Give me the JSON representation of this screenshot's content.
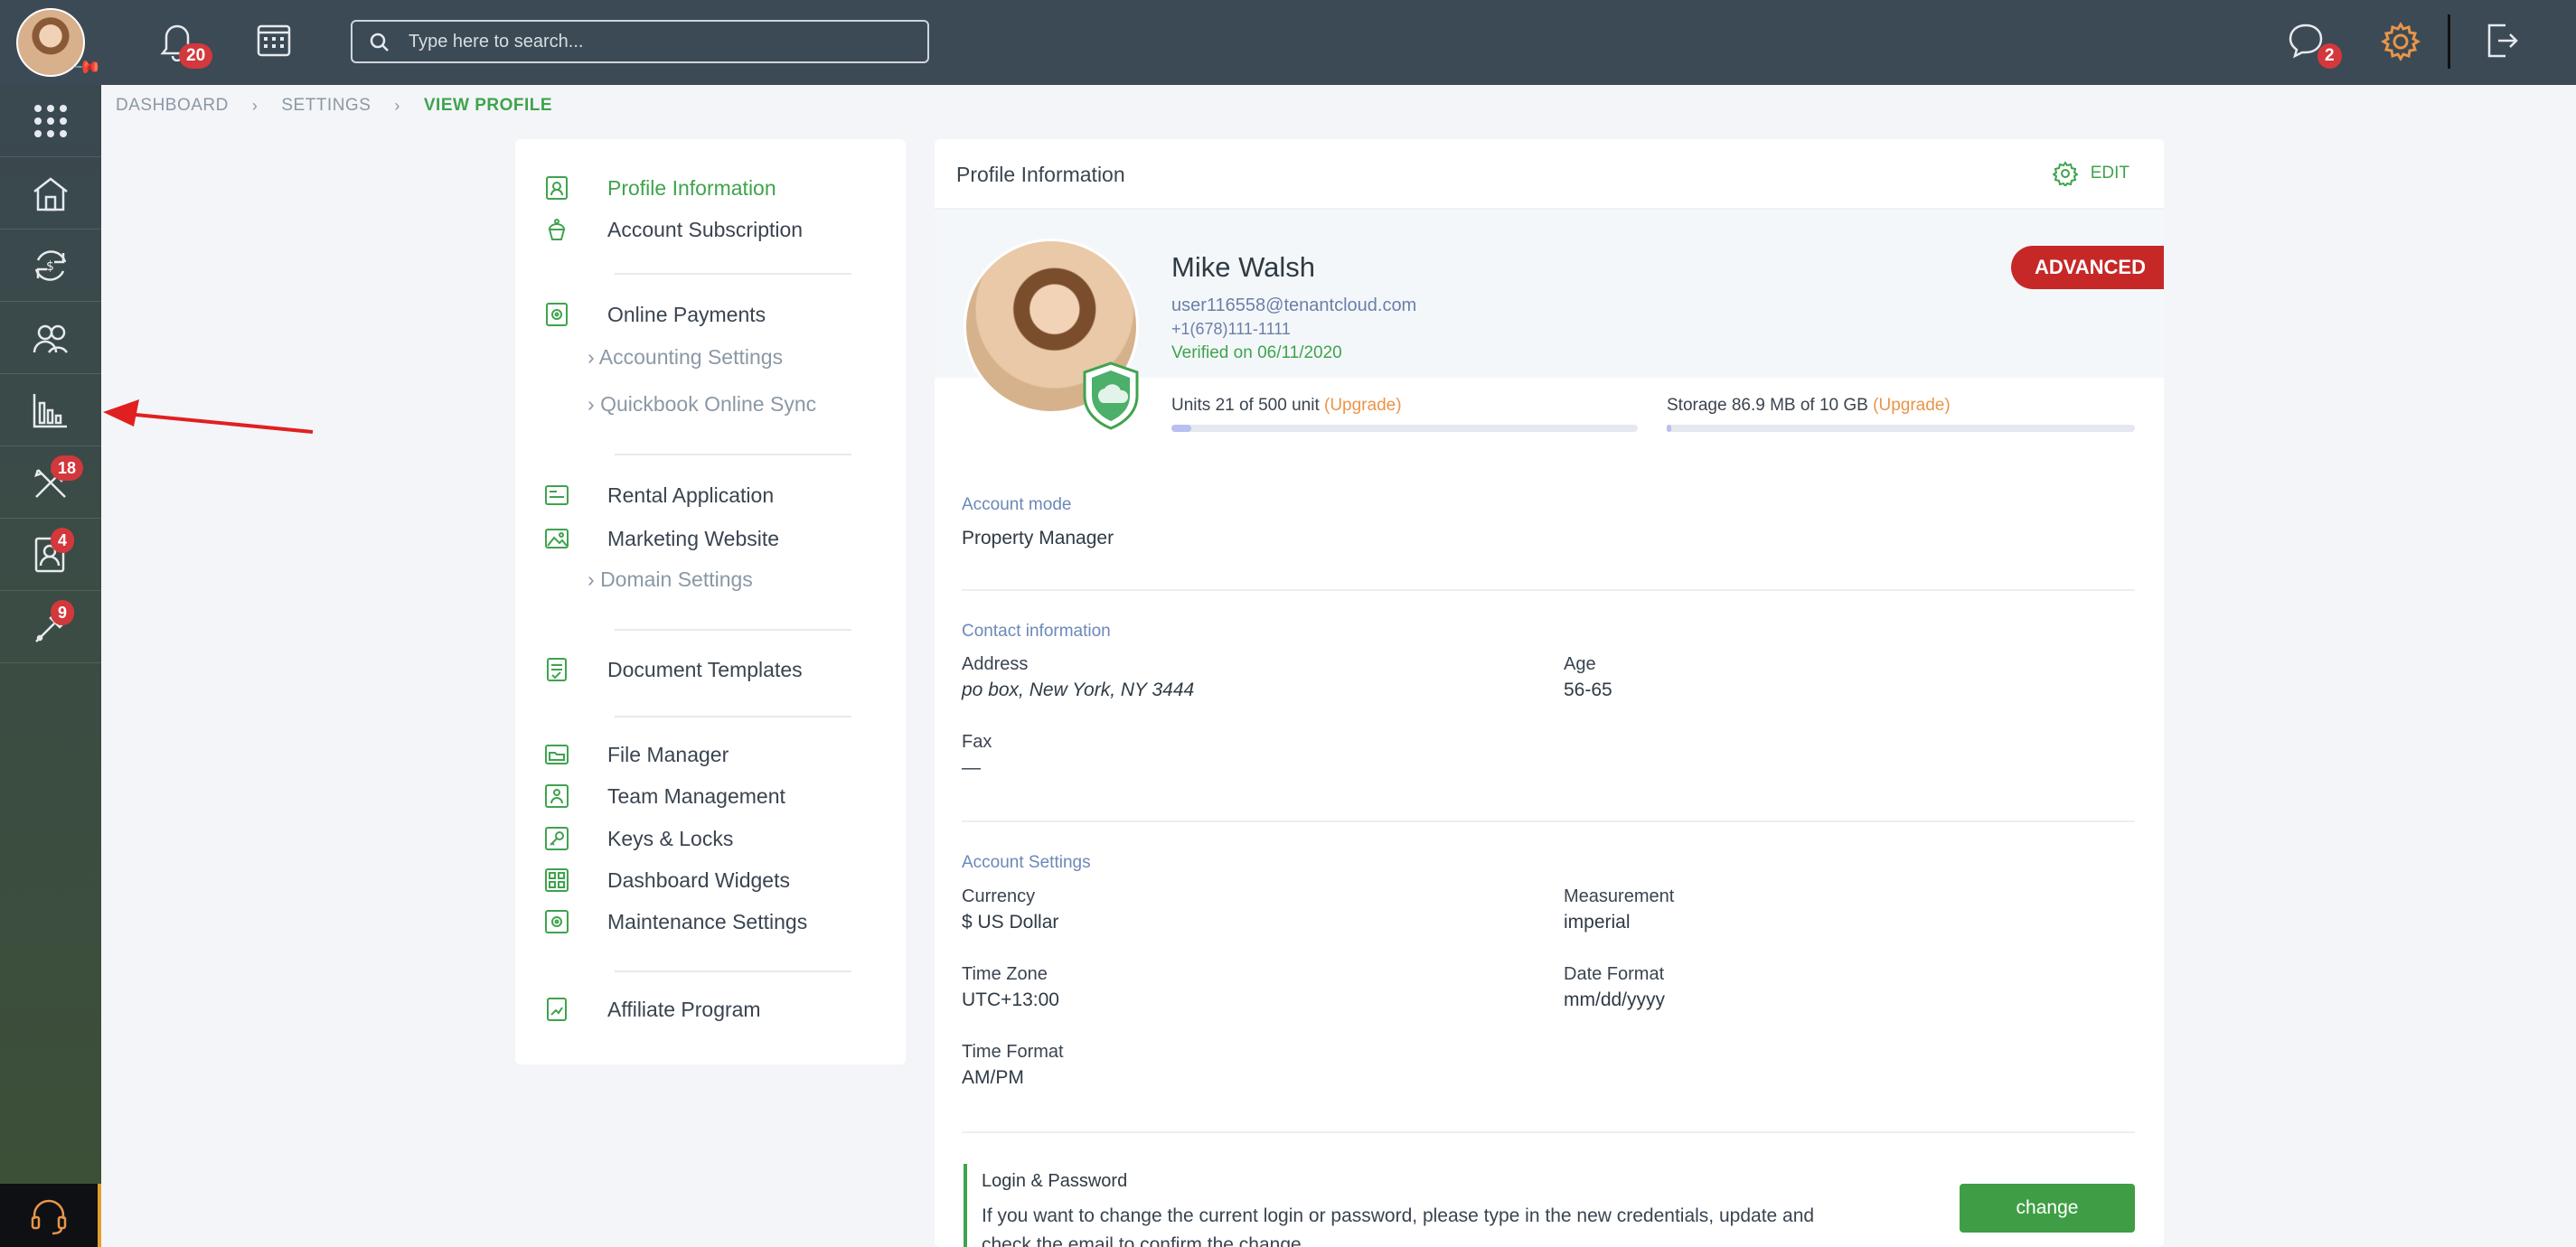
{
  "topbar": {
    "notifications_count": "20",
    "search_placeholder": "Type here to search...",
    "messages_count": "2"
  },
  "sidebar": {
    "items": [
      {
        "icon": "apps-grid-icon",
        "badge": ""
      },
      {
        "icon": "properties-icon",
        "badge": ""
      },
      {
        "icon": "payments-exchange-icon",
        "badge": ""
      },
      {
        "icon": "contacts-icon",
        "badge": ""
      },
      {
        "icon": "reports-chart-icon",
        "badge": ""
      },
      {
        "icon": "maintenance-tools-icon",
        "badge": "18"
      },
      {
        "icon": "applicants-icon",
        "badge": "4"
      },
      {
        "icon": "services-wrench-icon",
        "badge": "9"
      }
    ]
  },
  "breadcrumb": [
    "DASHBOARD",
    "SETTINGS",
    "VIEW PROFILE"
  ],
  "menu": {
    "profile_information": "Profile Information",
    "account_subscription": "Account Subscription",
    "online_payments": "Online Payments",
    "accounting_settings": "Accounting Settings",
    "quickbook_sync": "Quickbook Online Sync",
    "rental_application": "Rental Application",
    "marketing_website": "Marketing Website",
    "domain_settings": "Domain Settings",
    "document_templates": "Document Templates",
    "file_manager": "File Manager",
    "team_management": "Team Management",
    "keys_locks": "Keys & Locks",
    "dashboard_widgets": "Dashboard Widgets",
    "maintenance_settings": "Maintenance Settings",
    "affiliate_program": "Affiliate Program"
  },
  "profile": {
    "card_title": "Profile Information",
    "edit_label": "EDIT",
    "name": "Mike Walsh",
    "email": "user116558@tenantcloud.com",
    "phone": "+1(678)111-1111",
    "verified": "Verified on 06/11/2020",
    "plan": "ADVANCED",
    "units_text": "Units 21 of 500 unit",
    "units_fraction": 0.042,
    "storage_text": "Storage 86.9 MB of 10 GB",
    "storage_fraction": 0.009,
    "upgrade_label": "(Upgrade)"
  },
  "account_mode": {
    "title": "Account mode",
    "value": "Property Manager"
  },
  "contact": {
    "title": "Contact information",
    "address_label": "Address",
    "address_value": "po box, New York, NY 3444",
    "age_label": "Age",
    "age_value": "56-65",
    "fax_label": "Fax",
    "fax_value": "—"
  },
  "account_settings": {
    "title": "Account Settings",
    "currency_label": "Currency",
    "currency_value": "$ US Dollar",
    "measurement_label": "Measurement",
    "measurement_value": "imperial",
    "timezone_label": "Time Zone",
    "timezone_value": "UTC+13:00",
    "dateformat_label": "Date Format",
    "dateformat_value": "mm/dd/yyyy",
    "timeformat_label": "Time Format",
    "timeformat_value": "AM/PM"
  },
  "login": {
    "title": "Login & Password",
    "text": "If you want to change the current login or password, please type in the new credentials, update and check the email to confirm the change.",
    "button": "change"
  },
  "colors": {
    "accent_green": "#3fa34d",
    "badge_red": "#d2383c",
    "plan_red": "#c62828",
    "upgrade_orange": "#e8954a",
    "topbar": "#3c4a55"
  }
}
